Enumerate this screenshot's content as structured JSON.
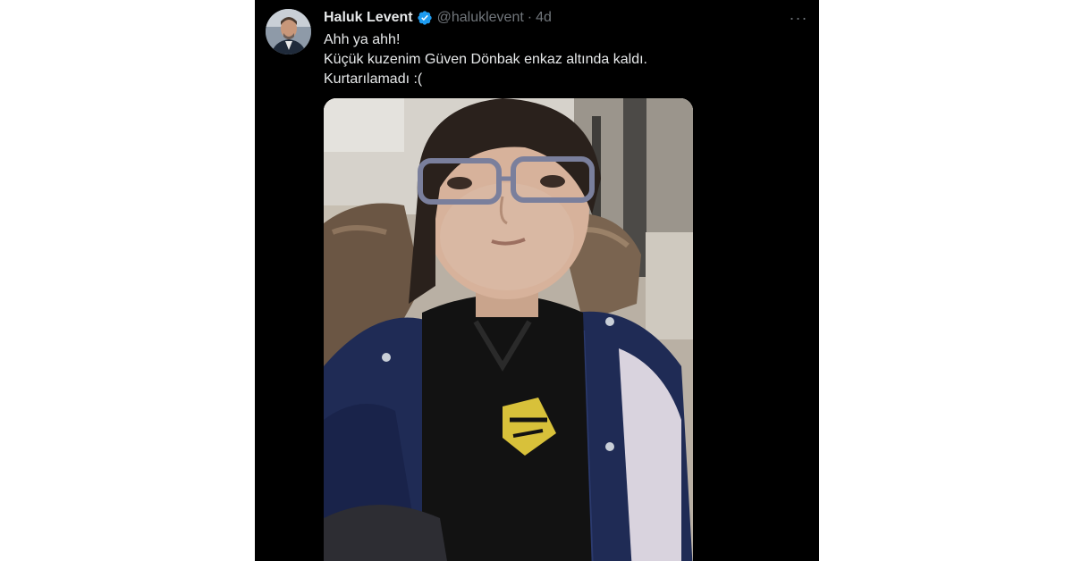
{
  "tweet": {
    "author": {
      "display_name": "Haluk Levent",
      "handle": "@haluklevent",
      "verified": true,
      "avatar_icon": "user-avatar"
    },
    "separator": "·",
    "time": "4d",
    "more_icon": "more-options-icon",
    "more_label": "···",
    "text_lines": [
      "Ahh ya ahh!",
      "Küçük kuzenim Güven Dönbak enkaz altında kaldı.",
      "Kurtarılamadı :("
    ],
    "media": {
      "type": "photo",
      "subject": "person-photo"
    }
  },
  "colors": {
    "background": "#000000",
    "page_background": "#ffffff",
    "primary_text": "#e7e9ea",
    "secondary_text": "#71767b",
    "verified_badge": "#1d9bf0"
  }
}
